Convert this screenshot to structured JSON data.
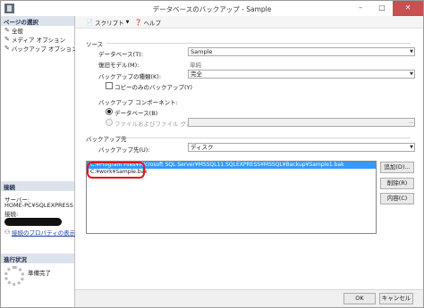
{
  "window": {
    "title": "データベースのバックアップ - Sample",
    "minimize": "–",
    "maximize": "□",
    "close": "✕"
  },
  "toolbar": {
    "script_label": "スクリプト",
    "help_label": "ヘルプ"
  },
  "sidebar": {
    "pages_header": "ページの選択",
    "pages": [
      {
        "label": "全般",
        "icon": "page-icon"
      },
      {
        "label": "メディア オプション",
        "icon": "page-icon"
      },
      {
        "label": "バックアップ オプション",
        "icon": "page-icon"
      }
    ],
    "connection_header": "接続",
    "server_label": "サーバー:",
    "server_value": "HOME-PC¥SQLEXPRESS",
    "connection_label": "接続:",
    "connection_link": "接続のプロパティの表示",
    "progress_header": "進行状況",
    "progress_status": "準備完了"
  },
  "source": {
    "section_label": "ソース",
    "database_label": "データベース(T):",
    "database_value": "Sample",
    "recovery_label": "復旧モデル(M):",
    "recovery_value": "単純",
    "backup_type_label": "バックアップの種類(K):",
    "backup_type_value": "完全",
    "copy_only_label": "コピーのみのバックアップ(Y)",
    "copy_only_checked": false,
    "component_label": "バックアップ コンポーネント:",
    "radio_database_label": "データベース(B)",
    "radio_files_label": "ファイルおよびファイル グループ(G):"
  },
  "destination": {
    "section_label": "バックアップ先",
    "backup_to_label": "バックアップ先(U):",
    "backup_to_value": "ディスク",
    "list_items": [
      "C:¥Program Files¥Microsoft SQL Server¥MSSQL11.SQLEXPRESS¥MSSQL¥Backup¥Sample1.bak",
      "C:¥work¥Sample.bak"
    ],
    "add_button": "追加(D)...",
    "remove_button": "削除(R)",
    "contents_button": "内容(C)"
  },
  "footer": {
    "ok_label": "OK",
    "cancel_label": "キャンセル"
  },
  "colors": {
    "selection": "#3399ff",
    "annotation": "#e0141c",
    "close_button": "#c75050"
  }
}
